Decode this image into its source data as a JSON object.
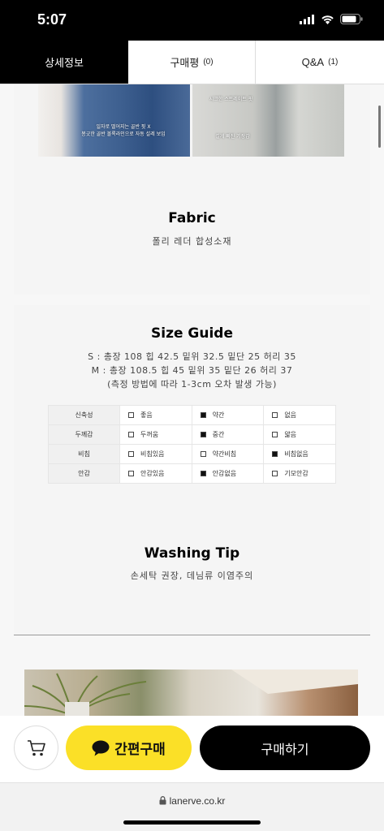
{
  "status": {
    "time": "5:07"
  },
  "tabs": [
    {
      "label": "상세정보",
      "count": ""
    },
    {
      "label": "구매평",
      "count": "(0)"
    },
    {
      "label": "Q&A",
      "count": "(1)"
    }
  ],
  "photos": {
    "left_caption": "일자로 떨어지는 골반 핏 X\n봉긋한 골반 볼록라인으로 자동 설레 보임",
    "right_caption_top": "시크한 스트레이트 핏",
    "right_caption_bottom": "길게 빠진 기장감"
  },
  "fabric": {
    "title": "Fabric",
    "text": "폴리 레더 합성소재"
  },
  "size_guide": {
    "title": "Size Guide",
    "line1": "S : 총장 108 힙 42.5 밑위 32.5 밑단 25 허리 35",
    "line2": "M : 총장 108.5 힙 45 밑위 35 밑단 26 허리 37",
    "line3": "(측정 방법에 따라 1-3cm 오차 발생 가능)",
    "rows": [
      {
        "label": "신축성",
        "options": [
          "좋음",
          "약간",
          "없음"
        ],
        "selected": 1
      },
      {
        "label": "두께감",
        "options": [
          "두꺼움",
          "중간",
          "얇음"
        ],
        "selected": 1
      },
      {
        "label": "비침",
        "options": [
          "비침있음",
          "약간비침",
          "비침없음"
        ],
        "selected": 2
      },
      {
        "label": "안감",
        "options": [
          "안감있음",
          "안감없음",
          "기모안감"
        ],
        "selected": 1
      }
    ]
  },
  "washing": {
    "title": "Washing Tip",
    "text": "손세탁 권장, 데님류 이염주의"
  },
  "actions": {
    "kakao_label": "간편구매",
    "buy_label": "구매하기"
  },
  "browser": {
    "url": "lanerve.co.kr"
  }
}
